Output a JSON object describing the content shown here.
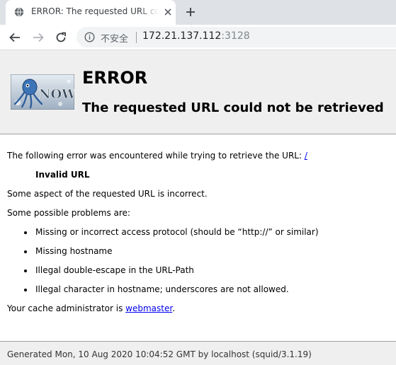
{
  "browser": {
    "tab": {
      "title": "ERROR: The requested URL could not be retrieved",
      "favicon": "globe-icon",
      "close_icon": "close-icon"
    },
    "new_tab_icon": "plus-icon",
    "toolbar": {
      "back_icon": "back-arrow-icon",
      "forward_icon": "forward-arrow-icon",
      "reload_icon": "reload-icon",
      "info_icon": "info-icon",
      "security_label": "不安全",
      "url_host": "172.21.137.112",
      "url_port": ":3128"
    }
  },
  "page": {
    "logo_text": "NOW",
    "heading": "ERROR",
    "subheading": "The requested URL could not be retrieved",
    "intro_text": "The following error was encountered while trying to retrieve the URL: ",
    "intro_link": "/",
    "error_name": "Invalid URL",
    "error_description": "Some aspect of the requested URL is incorrect.",
    "problems_intro": "Some possible problems are:",
    "problems": [
      "Missing or incorrect access protocol (should be “http://” or similar)",
      "Missing hostname",
      "Illegal double-escape in the URL-Path",
      "Illegal character in hostname; underscores are not allowed."
    ],
    "admin_text": "Your cache administrator is ",
    "admin_link": "webmaster",
    "admin_suffix": ".",
    "footer": "Generated Mon, 10 Aug 2020 10:04:52 GMT by localhost (squid/3.1.19)"
  }
}
